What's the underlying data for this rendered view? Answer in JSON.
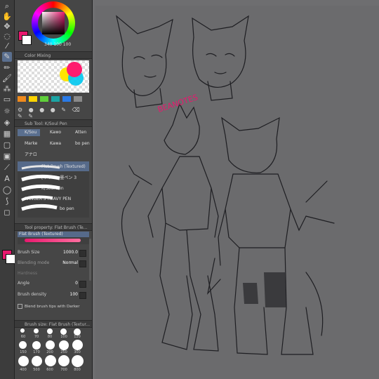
{
  "colors": {
    "main": "#e8186e",
    "sub": "#ffffff",
    "accent": "#5a6f8f"
  },
  "color_wheel": {
    "readout": "340 100 100"
  },
  "color_mixing": {
    "title": "Color Mixing"
  },
  "sub_tool": {
    "title": "Sub Tool: K/Soul Pen",
    "items": [
      {
        "label": "K/Sou",
        "icon": "pen-icon"
      },
      {
        "label": "Kawo",
        "icon": "pen-icon"
      },
      {
        "label": "Atten",
        "icon": "pen-icon"
      },
      {
        "label": "Marke",
        "icon": "marker-icon"
      },
      {
        "label": "Kawa",
        "icon": "pen-icon"
      },
      {
        "label": "bo pen",
        "icon": "pen-icon"
      },
      {
        "label": "アナロ",
        "icon": "pen-icon"
      }
    ]
  },
  "brush_list": [
    {
      "label": "Flat Brush (Textured)"
    },
    {
      "label": "[サイドン墨ペン 3"
    },
    {
      "label": "K/Soul Pen"
    },
    {
      "label": "RANGER'S HEAVY PEN"
    },
    {
      "label": "bo pen"
    }
  ],
  "tool_property": {
    "title": "Tool property: Flat Brush (Te...",
    "selected": "Flat Brush (Textured)",
    "rows": [
      {
        "label": "Brush Size",
        "value": "1000.0"
      },
      {
        "label": "Blending mode",
        "value": "Normal"
      },
      {
        "label": "Hardness",
        "value": ""
      },
      {
        "label": "Angle",
        "value": "0"
      },
      {
        "label": "Brush density",
        "value": "100"
      }
    ],
    "checkbox": "Blend brush tips with Darker"
  },
  "brush_size": {
    "title": "Brush size: Flat Brush (Textur...",
    "values": [
      "60",
      "70",
      "80",
      "100",
      "120",
      "150",
      "170",
      "200",
      "250",
      "300",
      "400",
      "500",
      "600",
      "700",
      "800"
    ]
  },
  "canvas": {
    "text": "BEANOTES"
  }
}
